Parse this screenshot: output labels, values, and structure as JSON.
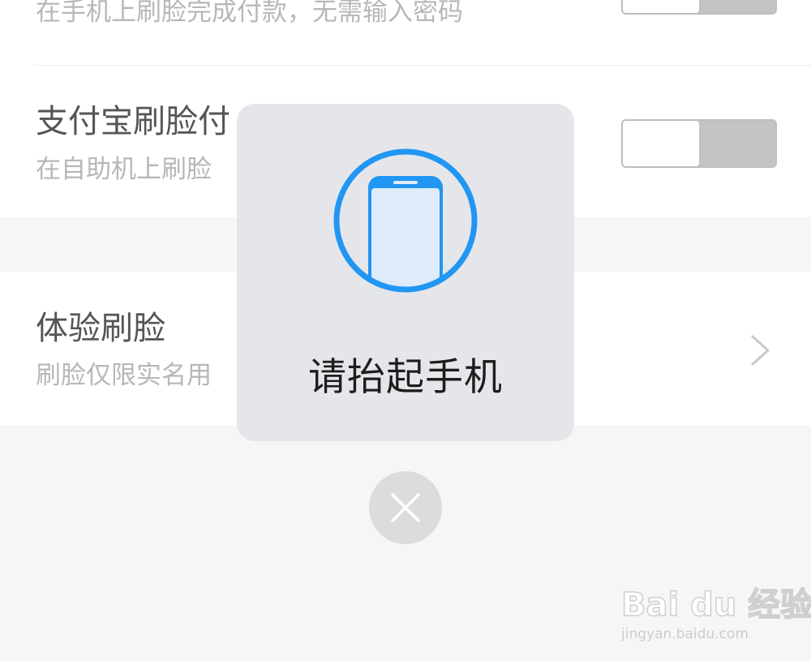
{
  "settings": {
    "row1": {
      "subtitle": "在手机上刷脸完成付款，无需输入密码"
    },
    "row2": {
      "title": "支付宝刷脸付",
      "subtitle": "在自助机上刷脸"
    },
    "row3": {
      "title": "体验刷脸",
      "subtitle": "刷脸仅限实名用"
    }
  },
  "dialog": {
    "icon": "phone-in-circle-icon",
    "message": "请抬起手机"
  },
  "close_button": {
    "icon": "close-icon"
  },
  "watermark": {
    "logo": "Bai du 经验",
    "url": "jingyan.baidu.com"
  },
  "colors": {
    "accent_blue": "#2196f3",
    "dialog_bg": "#e5e6ea",
    "toggle_track": "#c2c4c1",
    "page_bg": "#f6f6f6"
  }
}
